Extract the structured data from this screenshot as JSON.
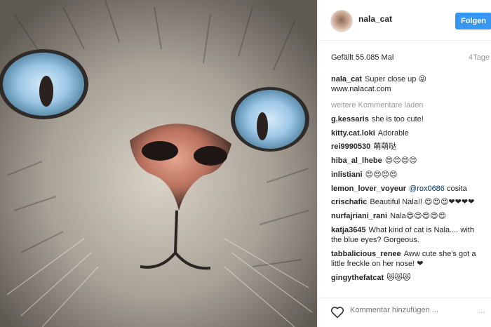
{
  "post": {
    "username": "nala_cat",
    "follow_label": "Folgen",
    "likes_text": "Gefällt 55.085 Mal",
    "time_text": "4Tage",
    "caption_user": "nala_cat",
    "caption_text": "Super close up 😜 www.nalacat.com",
    "more_comments": "weitere Kommentare laden"
  },
  "comments": [
    {
      "user": "g.kessaris",
      "text": "she is too cute!"
    },
    {
      "user": "kitty.cat.loki",
      "text": "Adorable"
    },
    {
      "user": "rei9990530",
      "text": "萌萌哒"
    },
    {
      "user": "hiba_al_lhebe",
      "text": "😍😍😍😍"
    },
    {
      "user": "inlistiani",
      "text": "😍😍😍😍"
    },
    {
      "user": "lemon_lover_voyeur",
      "mention": "@rox0686",
      "text": "cosita"
    },
    {
      "user": "crischafic",
      "text": "Beautiful Nala!! 😍😍😍❤❤❤❤"
    },
    {
      "user": "nurfajriani_rani",
      "text": "Nala😍😍😍😍😍"
    },
    {
      "user": "katja3645",
      "text": "What kind of cat is Nala.... with the blue eyes? Gorgeous."
    },
    {
      "user": "tabbalicious_renee",
      "text": "Aww cute she's got a little freckle on her nose! ❤"
    },
    {
      "user": "gingythefatcat",
      "text": "😻😻😻"
    }
  ],
  "footer": {
    "placeholder": "Kommentar hinzufügen ...",
    "more_icon": "…"
  },
  "icons": {
    "heart": "heart-icon",
    "more": "more-options-icon"
  }
}
